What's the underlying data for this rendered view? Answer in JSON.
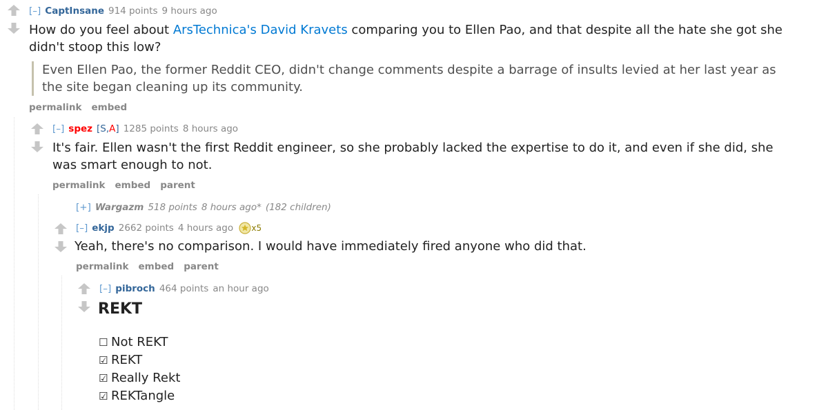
{
  "comments": [
    {
      "toggle": "[–]",
      "author": "CaptInsane",
      "points": "914 points",
      "time": "9 hours ago",
      "body_prefix": "How do you feel about ",
      "body_link": "ArsTechnica's David Kravets",
      "body_suffix": " comparing you to Ellen Pao, and that despite all the hate she got she didn't stoop this low?",
      "quote": "Even Ellen Pao, the former Reddit CEO, didn't change comments despite a barrage of insults levied at her last year as the site began cleaning up its community.",
      "buttons": [
        "permalink",
        "embed"
      ]
    },
    {
      "toggle": "[–]",
      "author": "spez",
      "flag_open": "[",
      "flag_s": "S",
      "flag_sep": ",",
      "flag_a": "A",
      "flag_close": "]",
      "points": "1285 points",
      "time": "8 hours ago",
      "body": "It's fair. Ellen wasn't the first Reddit engineer, so she probably lacked the expertise to do it, and even if she did, she was smart enough to not.",
      "buttons": [
        "permalink",
        "embed",
        "parent"
      ]
    },
    {
      "toggle": "[+]",
      "author": "Wargazm",
      "points": "518 points",
      "time": "8 hours ago*",
      "children": "(182 children)"
    },
    {
      "toggle": "[–]",
      "author": "ekjp",
      "points": "2662 points",
      "time": "4 hours ago",
      "gild_count": "x5",
      "body": "Yeah, there's no comparison. I would have immediately fired anyone who did that.",
      "buttons": [
        "permalink",
        "embed",
        "parent"
      ]
    },
    {
      "toggle": "[–]",
      "author": "pibroch",
      "points": "464 points",
      "time": "an hour ago",
      "heading": "REKT",
      "checklist": [
        {
          "box": "☐",
          "label": "Not REKT"
        },
        {
          "box": "☑",
          "label": "REKT"
        },
        {
          "box": "☑",
          "label": "Really Rekt"
        },
        {
          "box": "☑",
          "label": "REKTangle"
        }
      ]
    }
  ],
  "colors": {
    "author_link": "#336699",
    "admin_author": "#ff0000",
    "body_link": "#0079d3",
    "muted": "#888888",
    "arrow": "#c6c6c6"
  },
  "icons": {
    "upvote": "upvote-arrow-icon",
    "downvote": "downvote-arrow-icon",
    "gild": "gold-award-icon"
  }
}
